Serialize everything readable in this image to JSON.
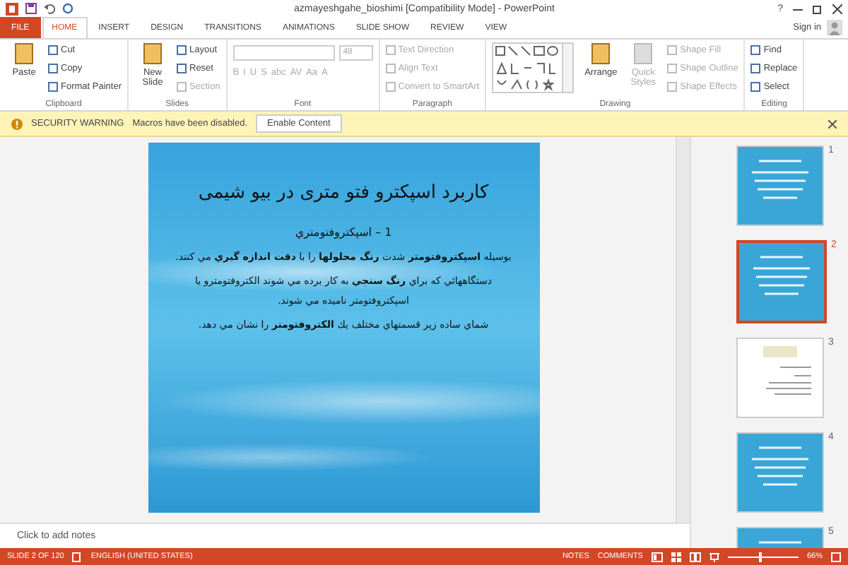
{
  "window": {
    "title": "azmayeshgahe_bioshimi [Compatibility Mode] - PowerPoint",
    "help": "?",
    "sign_in": "Sign in"
  },
  "tabs": [
    {
      "label": "FILE",
      "kind": "file",
      "selected": false
    },
    {
      "label": "HOME",
      "kind": "tab",
      "selected": true
    },
    {
      "label": "INSERT",
      "kind": "tab",
      "selected": false
    },
    {
      "label": "DESIGN",
      "kind": "tab",
      "selected": false
    },
    {
      "label": "TRANSITIONS",
      "kind": "tab",
      "selected": false
    },
    {
      "label": "ANIMATIONS",
      "kind": "tab",
      "selected": false
    },
    {
      "label": "SLIDE SHOW",
      "kind": "tab",
      "selected": false
    },
    {
      "label": "REVIEW",
      "kind": "tab",
      "selected": false
    },
    {
      "label": "VIEW",
      "kind": "tab",
      "selected": false
    }
  ],
  "ribbon": [
    {
      "label": "Clipboard",
      "kind": "buttons",
      "columns": [
        [
          {
            "label": "Paste",
            "kind": "large",
            "disabled": false
          }
        ],
        [
          {
            "label": "Cut",
            "kind": "small",
            "disabled": false
          },
          {
            "label": "Copy",
            "kind": "small",
            "disabled": false
          },
          {
            "label": "Format Painter",
            "kind": "small",
            "disabled": false
          }
        ]
      ]
    },
    {
      "label": "Slides",
      "kind": "buttons",
      "columns": [
        [
          {
            "label": "New Slide",
            "kind": "large",
            "disabled": false
          }
        ],
        [
          {
            "label": "Layout",
            "kind": "small",
            "disabled": false
          },
          {
            "label": "Reset",
            "kind": "small",
            "disabled": false
          },
          {
            "label": "Section",
            "kind": "small",
            "disabled": true
          }
        ]
      ]
    },
    {
      "label": "Font",
      "kind": "font",
      "size": "48",
      "format_buttons": [
        "B",
        "I",
        "U",
        "S",
        "abc",
        "AV",
        "Aa",
        "A"
      ]
    },
    {
      "label": "Paragraph",
      "kind": "buttons",
      "columns": [
        [
          {
            "label": "Text Direction",
            "kind": "small",
            "disabled": true
          },
          {
            "label": "Align Text",
            "kind": "small",
            "disabled": true
          },
          {
            "label": "Convert to SmartArt",
            "kind": "small",
            "disabled": true
          }
        ]
      ]
    },
    {
      "label": "Drawing",
      "kind": "shapes",
      "columns": [
        [
          {
            "label": "Arrange",
            "kind": "large",
            "disabled": false
          }
        ],
        [
          {
            "label": "Quick Styles",
            "kind": "large",
            "disabled": true
          }
        ],
        [
          {
            "label": "Shape Fill",
            "kind": "small",
            "disabled": true
          },
          {
            "label": "Shape Outline",
            "kind": "small",
            "disabled": true
          },
          {
            "label": "Shape Effects",
            "kind": "small",
            "disabled": true
          }
        ]
      ]
    },
    {
      "label": "Editing",
      "kind": "buttons",
      "columns": [
        [
          {
            "label": "Find",
            "kind": "small",
            "disabled": false
          },
          {
            "label": "Replace",
            "kind": "small",
            "disabled": false
          },
          {
            "label": "Select",
            "kind": "small",
            "disabled": false
          }
        ]
      ]
    }
  ],
  "security_bar": {
    "title": "SECURITY WARNING",
    "message": "Macros have been disabled.",
    "button": "Enable Content"
  },
  "slide": {
    "title": "کاربرد اسپکترو فتو متری در بیو شیمی",
    "paragraphs": [
      {
        "kind": "subtitle",
        "text": "1 – اسپكتروفتومتري"
      },
      {
        "kind": "body",
        "text": "بوسيله **اسپكتروفتومتر** شدت **رنگ محلولها** را با **دقت اندازه گيري** مي كنند."
      },
      {
        "kind": "body",
        "text": "دستگاههائي كه براي **رنگ سنجي** به كار برده مي شوند الكتروفتومترو يا اسپكتروفتومتر ناميده مي شوند."
      },
      {
        "kind": "body",
        "text": "شماي ساده زير قسمتهاي مختلف يك **الكتروفتومتر** را نشان مي دهد."
      }
    ]
  },
  "thumbnails": [
    {
      "number": "1",
      "kind": "blue",
      "selected": false
    },
    {
      "number": "2",
      "kind": "blue",
      "selected": true
    },
    {
      "number": "3",
      "kind": "white",
      "selected": false
    },
    {
      "number": "4",
      "kind": "blue",
      "selected": false
    },
    {
      "number": "5",
      "kind": "blue",
      "selected": false
    }
  ],
  "notes": {
    "placeholder": "Click to add notes"
  },
  "status_bar": {
    "slide": "SLIDE 2 OF 120",
    "language": "ENGLISH (UNITED STATES)",
    "notes": "NOTES",
    "comments": "COMMENTS",
    "zoom": {
      "level": 0.45,
      "reading": "66%"
    }
  }
}
